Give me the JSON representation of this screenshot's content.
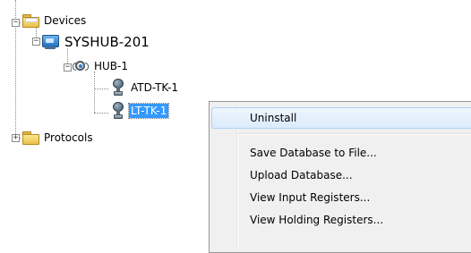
{
  "tree": {
    "devices": {
      "label": "Devices",
      "expander": "−"
    },
    "syshub": {
      "label": "SYSHUB-201",
      "expander": "−"
    },
    "hub": {
      "label": "HUB-1",
      "expander": "−"
    },
    "atd": {
      "label": "ATD-TK-1"
    },
    "lt": {
      "label": "LT-TK-1",
      "selected": true
    },
    "protocols": {
      "label": "Protocols",
      "expander": "+"
    }
  },
  "context_menu": {
    "items": [
      {
        "label": "Uninstall",
        "highlighted": true
      },
      {
        "label": "Save Database to File..."
      },
      {
        "label": "Upload Database..."
      },
      {
        "label": "View Input Registers..."
      },
      {
        "label": "View Holding Registers..."
      }
    ]
  },
  "colors": {
    "selection": "#3399ff",
    "menu_background": "#f0f0f0",
    "menu_highlight_border": "#aecff7"
  },
  "icons": {
    "devices": "folder-open-icon",
    "syshub": "system-hub-icon",
    "hub": "hub-icon",
    "atd": "transmitter-icon",
    "lt": "transmitter-icon",
    "protocols": "folder-icon"
  }
}
